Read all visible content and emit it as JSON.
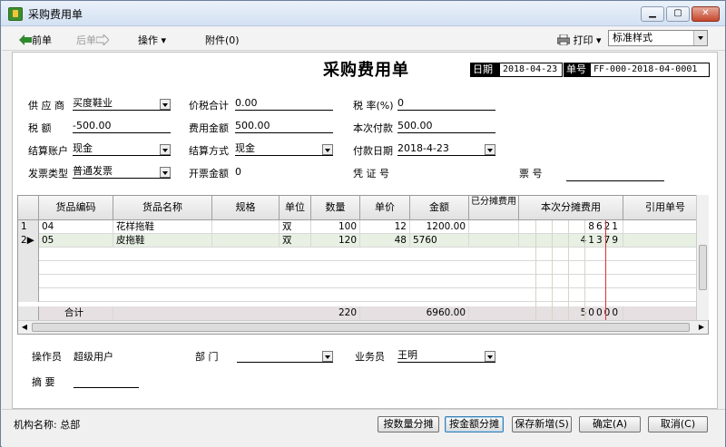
{
  "window": {
    "title": "采购费用单"
  },
  "toolbar": {
    "prev": "前单",
    "next": "后单",
    "ops": "操作",
    "attach": "附件(0)",
    "print": "打印",
    "style": "标准样式"
  },
  "doc": {
    "title": "采购费用单",
    "date_label": "日期",
    "date": "2018-04-23",
    "no_label": "单号",
    "no": "FF-000-2018-04-0001"
  },
  "form": {
    "supplier_label": "供 应 商",
    "supplier": "买度鞋业",
    "tax_total_label": "价税合计",
    "tax_total": "0.00",
    "tax_rate_label": "税 率(%)",
    "tax_rate": "0",
    "tax_label": "税    额",
    "tax": "-500.00",
    "fee_label": "费用金额",
    "fee": "500.00",
    "pay_now_label": "本次付款",
    "pay_now": "500.00",
    "account_label": "结算账户",
    "account": "现金",
    "settle_label": "结算方式",
    "settle": "现金",
    "pay_date_label": "付款日期",
    "pay_date": "2018-4-23",
    "invoice_type_label": "发票类型",
    "invoice_type": "普通发票",
    "invoice_amt_label": "开票金额",
    "invoice_amt": "0",
    "voucher_label": "凭 证 号",
    "ticket_label": "票    号"
  },
  "grid": {
    "columns": [
      "货品编码",
      "货品名称",
      "规格",
      "单位",
      "数量",
      "单价",
      "金额",
      "已分摊费用",
      "本次分摊费用",
      "引用单号"
    ],
    "rows": [
      {
        "idx": "1",
        "code": "04",
        "name": "花样拖鞋",
        "spec": "",
        "unit": "双",
        "qty": "100",
        "price": "12",
        "amount": "1200.00",
        "alloc_done": "",
        "alloc_now": "8621",
        "ref": ""
      },
      {
        "idx": "2",
        "code": "05",
        "name": "皮拖鞋",
        "spec": "",
        "unit": "双",
        "qty": "120",
        "price": "48",
        "amount": "5760",
        "alloc_done": "",
        "alloc_now": "41379",
        "ref": ""
      }
    ],
    "sum_label": "合计",
    "sum_qty": "220",
    "sum_amount": "6960.00",
    "sum_alloc_now": "50000"
  },
  "bottom": {
    "operator_label": "操作员",
    "operator": "超级用户",
    "dept_label": "部    门",
    "dept": "",
    "salesman_label": "业务员",
    "salesman": "王明",
    "summary_label": "摘    要",
    "summary": ""
  },
  "footer": {
    "org": "机构名称: 总部",
    "btn_qty": "按数量分摊",
    "btn_amt": "按金额分摊",
    "btn_save_new": "保存新增(S)",
    "btn_ok": "确定(A)",
    "btn_cancel": "取消(C)"
  }
}
